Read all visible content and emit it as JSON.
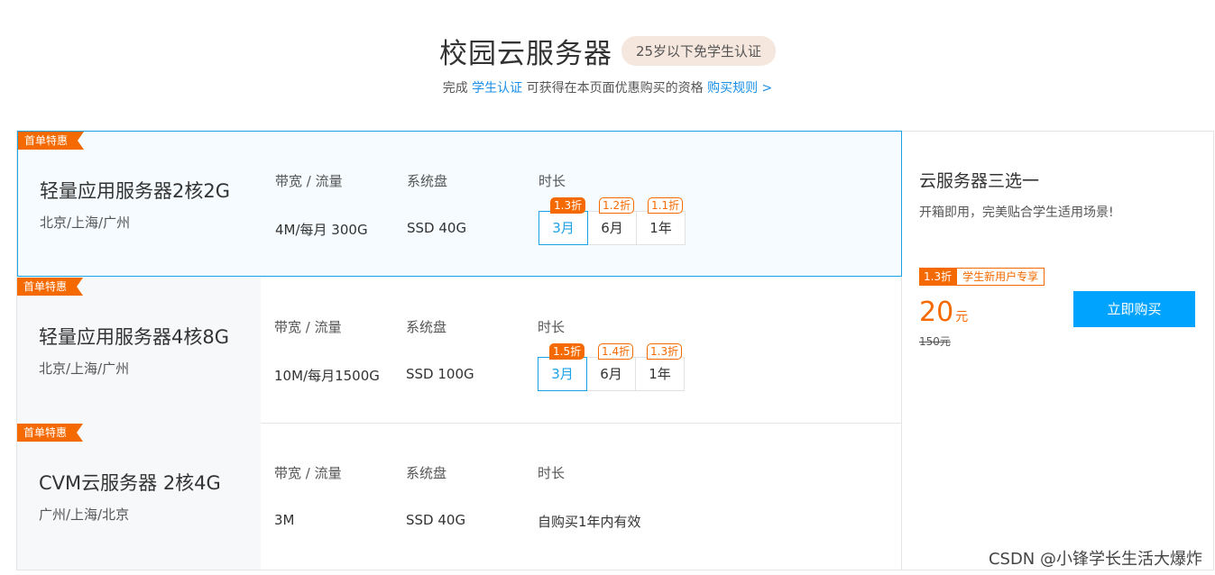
{
  "header": {
    "title": "校园云服务器",
    "badge": "25岁以下免学生认证",
    "subtitle_pre": "完成 ",
    "subtitle_link": "学生认证",
    "subtitle_mid": " 可获得在本页面优惠购买的资格 ",
    "rules_link": "购买规则 >"
  },
  "labels": {
    "bandwidth": "带宽 / 流量",
    "disk": "系统盘",
    "duration": "时长"
  },
  "products": [
    {
      "ribbon": "首单特惠",
      "name": "轻量应用服务器2核2G",
      "region": "北京/上海/广州",
      "bandwidth": "4M/每月 300G",
      "disk": "SSD 40G",
      "durations": [
        {
          "label": "3月",
          "discount": "1.3折"
        },
        {
          "label": "6月",
          "discount": "1.2折"
        },
        {
          "label": "1年",
          "discount": "1.1折"
        }
      ]
    },
    {
      "ribbon": "首单特惠",
      "name": "轻量应用服务器4核8G",
      "region": "北京/上海/广州",
      "bandwidth": "10M/每月1500G",
      "disk": "SSD 100G",
      "durations": [
        {
          "label": "3月",
          "discount": "1.5折"
        },
        {
          "label": "6月",
          "discount": "1.4折"
        },
        {
          "label": "1年",
          "discount": "1.3折"
        }
      ]
    },
    {
      "ribbon": "首单特惠",
      "name": "CVM云服务器 2核4G",
      "region": "广州/上海/北京",
      "bandwidth": "3M",
      "disk": "SSD 40G",
      "duration_text": "自购买1年内有效"
    }
  ],
  "side": {
    "title": "云服务器三选一",
    "desc": "开箱即用，完美贴合学生适用场景!",
    "promo_discount": "1.3折",
    "promo_label": "学生新用户专享",
    "price": "20",
    "unit": "元",
    "old_price": "150元",
    "buy_label": "立即购买"
  },
  "watermark": "CSDN @小锋学长生活大爆炸",
  "colors": {
    "accent_orange": "#f56a00",
    "accent_blue": "#1ba1e6",
    "buy_button": "#00a4ff"
  }
}
